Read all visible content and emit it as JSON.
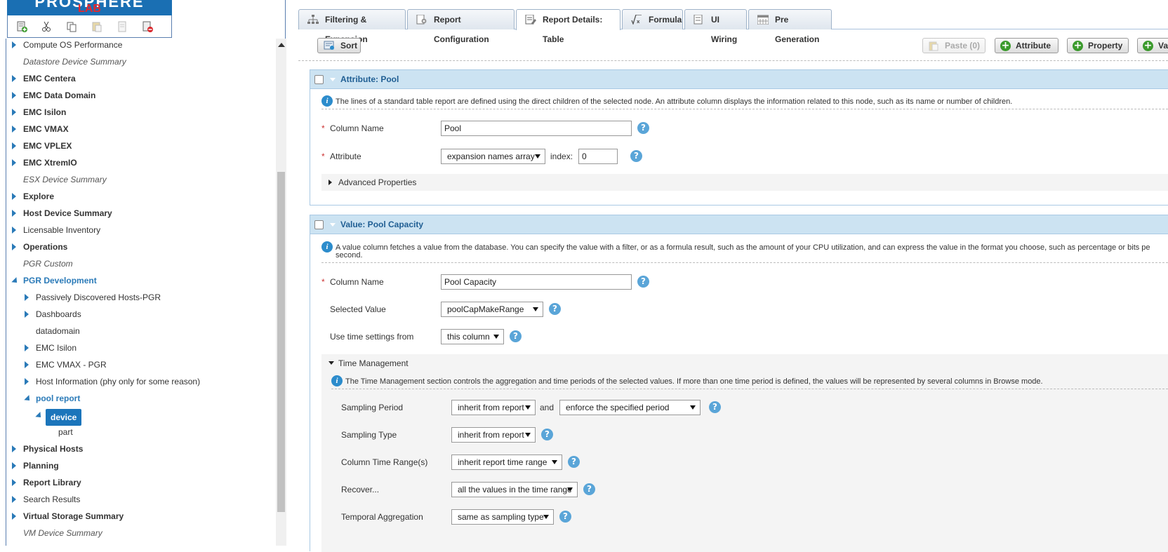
{
  "logo": {
    "line1": "PROSPHERE",
    "line2": "LAB"
  },
  "toolbar_icons": [
    "add-report-icon",
    "cut-icon",
    "copy-icon",
    "paste-icon",
    "paste-disabled-icon",
    "delete-icon"
  ],
  "tree": {
    "items": [
      {
        "label": "Compute OS Performance",
        "style": "norm",
        "arrow": "r"
      },
      {
        "label": "Datastore Device Summary",
        "style": "it",
        "arrow": ""
      },
      {
        "label": "EMC Centera",
        "style": "bold",
        "arrow": "r"
      },
      {
        "label": "EMC Data Domain",
        "style": "bold",
        "arrow": "r"
      },
      {
        "label": "EMC Isilon",
        "style": "bold",
        "arrow": "r"
      },
      {
        "label": "EMC VMAX",
        "style": "bold",
        "arrow": "r"
      },
      {
        "label": "EMC VPLEX",
        "style": "bold",
        "arrow": "r"
      },
      {
        "label": "EMC XtremIO",
        "style": "bold",
        "arrow": "r"
      },
      {
        "label": "ESX Device Summary",
        "style": "it",
        "arrow": ""
      },
      {
        "label": "Explore",
        "style": "bold",
        "arrow": "r"
      },
      {
        "label": "Host Device Summary",
        "style": "bold",
        "arrow": "r"
      },
      {
        "label": "Licensable Inventory",
        "style": "norm",
        "arrow": "r"
      },
      {
        "label": "Operations",
        "style": "bold",
        "arrow": "r"
      },
      {
        "label": "PGR Custom",
        "style": "it",
        "arrow": ""
      },
      {
        "label": "PGR Development",
        "style": "open",
        "arrow": "d"
      },
      {
        "label": "Passively Discovered Hosts-PGR",
        "style": "norm",
        "arrow": "r",
        "indent": 1
      },
      {
        "label": "Dashboards",
        "style": "norm",
        "arrow": "r",
        "indent": 1
      },
      {
        "label": "datadomain",
        "style": "norm",
        "arrow": "",
        "indent": 1
      },
      {
        "label": "EMC Isilon",
        "style": "norm",
        "arrow": "r",
        "indent": 1
      },
      {
        "label": "EMC VMAX - PGR",
        "style": "norm",
        "arrow": "r",
        "indent": 1
      },
      {
        "label": "Host Information (phy only for some reason)",
        "style": "norm",
        "arrow": "r",
        "indent": 1
      },
      {
        "label": "pool report",
        "style": "open",
        "arrow": "d",
        "indent": 1
      },
      {
        "label": "",
        "style": "norm",
        "arrow": "d",
        "indent": 2
      },
      {
        "label": "part",
        "style": "norm",
        "arrow": "",
        "indent": 3
      },
      {
        "label": "Physical Hosts",
        "style": "bold",
        "arrow": "r"
      },
      {
        "label": "Planning",
        "style": "bold",
        "arrow": "r"
      },
      {
        "label": "Report Library",
        "style": "bold",
        "arrow": "r"
      },
      {
        "label": "Search Results",
        "style": "norm",
        "arrow": "r"
      },
      {
        "label": "Virtual Storage Summary",
        "style": "bold",
        "arrow": "r"
      },
      {
        "label": "VM Device Summary",
        "style": "it",
        "arrow": ""
      }
    ],
    "selected": "device"
  },
  "tabs": [
    {
      "label": "Filtering & Expansion",
      "icon": "hierarchy-icon"
    },
    {
      "label": "Report Configuration",
      "icon": "report-config-icon"
    },
    {
      "label": "Report Details: Table",
      "icon": "report-table-icon",
      "active": true
    },
    {
      "label": "Formula",
      "icon": "formula-icon"
    },
    {
      "label": "UI Wiring",
      "icon": "ui-wiring-icon"
    },
    {
      "label": "Pre Generation",
      "icon": "calendar-icon"
    }
  ],
  "toolbar": {
    "sort": "Sort",
    "paste": "Paste (0)",
    "attribute": "Attribute",
    "property": "Property",
    "value_cut": "Va"
  },
  "panel1": {
    "title": "Attribute: Pool",
    "desc": "The lines of a standard table report are defined using the direct children of the selected node. An attribute column displays the information related to this node, such as its name or number of children.",
    "column_name_label": "Column Name",
    "column_name_value": "Pool",
    "attribute_label": "Attribute",
    "attribute_value": "expansion names array",
    "index_label": "index:",
    "index_value": "0",
    "advanced": "Advanced Properties"
  },
  "panel2": {
    "title": "Value: Pool Capacity",
    "desc_line1": "A value column fetches a value from the database. You can specify the value with a filter, or as a formula result, such as the amount of your CPU utilization, and can express the value in the format you choose, such as percentage or bits pe",
    "desc_line2": "second.",
    "column_name_label": "Column Name",
    "column_name_value": "Pool Capacity",
    "selected_value_label": "Selected Value",
    "selected_value": "poolCapMakeRange",
    "time_settings_label": "Use time settings from",
    "time_settings_value": "this column",
    "time_mgmt": {
      "title": "Time Management",
      "desc": "The Time Management section controls the aggregation and time periods of the selected values. If more than one time period is defined, the values will be represented by several columns in Browse mode.",
      "sampling_period_label": "Sampling Period",
      "sampling_period_value": "inherit from report",
      "and_label": "and",
      "enforce_value": "enforce the specified period",
      "sampling_type_label": "Sampling Type",
      "sampling_type_value": "inherit from report",
      "column_range_label": "Column Time Range(s)",
      "column_range_value": "inherit report time range",
      "recover_label": "Recover...",
      "recover_value": "all the values in the time range",
      "temporal_label": "Temporal Aggregation",
      "temporal_value": "same as sampling type"
    }
  },
  "colors": {
    "accent": "#1b75bb",
    "panel_header": "#cce3f2",
    "add_green": "#3b9a2c"
  }
}
